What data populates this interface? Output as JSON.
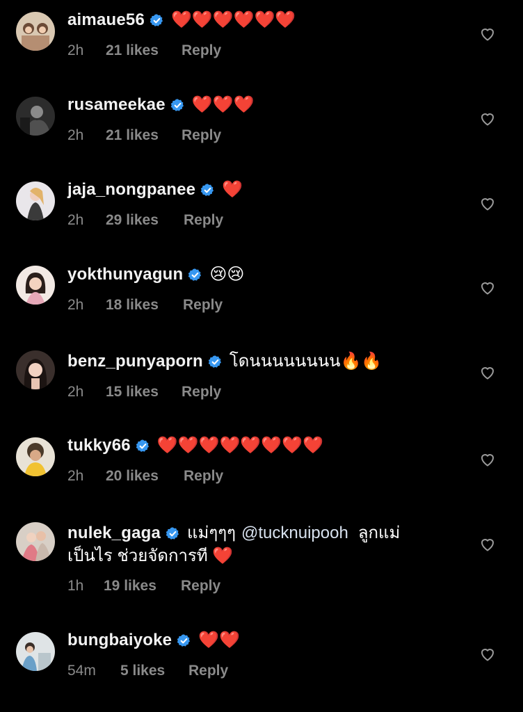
{
  "colors": {
    "background": "#000000",
    "username": "#f2f2f2",
    "meta": "#8a8a8a",
    "verified_badge": "#3797f0",
    "red_heart": "#e0203a"
  },
  "icons": {
    "verified": "verified-badge-icon",
    "like": "heart-outline-icon",
    "emoji_heart": "red-heart-emoji",
    "emoji_cry": "crying-face-emoji",
    "emoji_fire": "fire-emoji"
  },
  "comments": [
    {
      "username": "aimaue56",
      "text": "❤️❤️❤️❤️❤️❤️",
      "time": "2h",
      "likes": "21 likes",
      "reply": "Reply"
    },
    {
      "username": "rusameekae",
      "text": "❤️❤️❤️",
      "time": "2h",
      "likes": "21 likes",
      "reply": "Reply"
    },
    {
      "username": "jaja_nongpanee",
      "text": "❤️",
      "time": "2h",
      "likes": "29 likes",
      "reply": "Reply"
    },
    {
      "username": "yokthunyagun",
      "text": "😢😢",
      "time": "2h",
      "likes": "18 likes",
      "reply": "Reply"
    },
    {
      "username": "benz_punyaporn",
      "text": "โดนนนนนนนน🔥🔥",
      "time": "2h",
      "likes": "15 likes",
      "reply": "Reply"
    },
    {
      "username": "tukky66",
      "text": "❤️❤️❤️❤️❤️❤️❤️❤️",
      "time": "2h",
      "likes": "20 likes",
      "reply": "Reply"
    },
    {
      "username": "nulek_gaga",
      "text_part1": "แม่ๆๆๆ",
      "mention": "@tucknuipooh",
      "text_part2": "ลูกแม่",
      "text_line2": "เป็นไร ช่วยจัดการที ❤️",
      "time": "1h",
      "likes": "19 likes",
      "reply": "Reply"
    },
    {
      "username": "bungbaiyoke",
      "text": "❤️❤️",
      "time": "54m",
      "likes": "5 likes",
      "reply": "Reply"
    }
  ]
}
